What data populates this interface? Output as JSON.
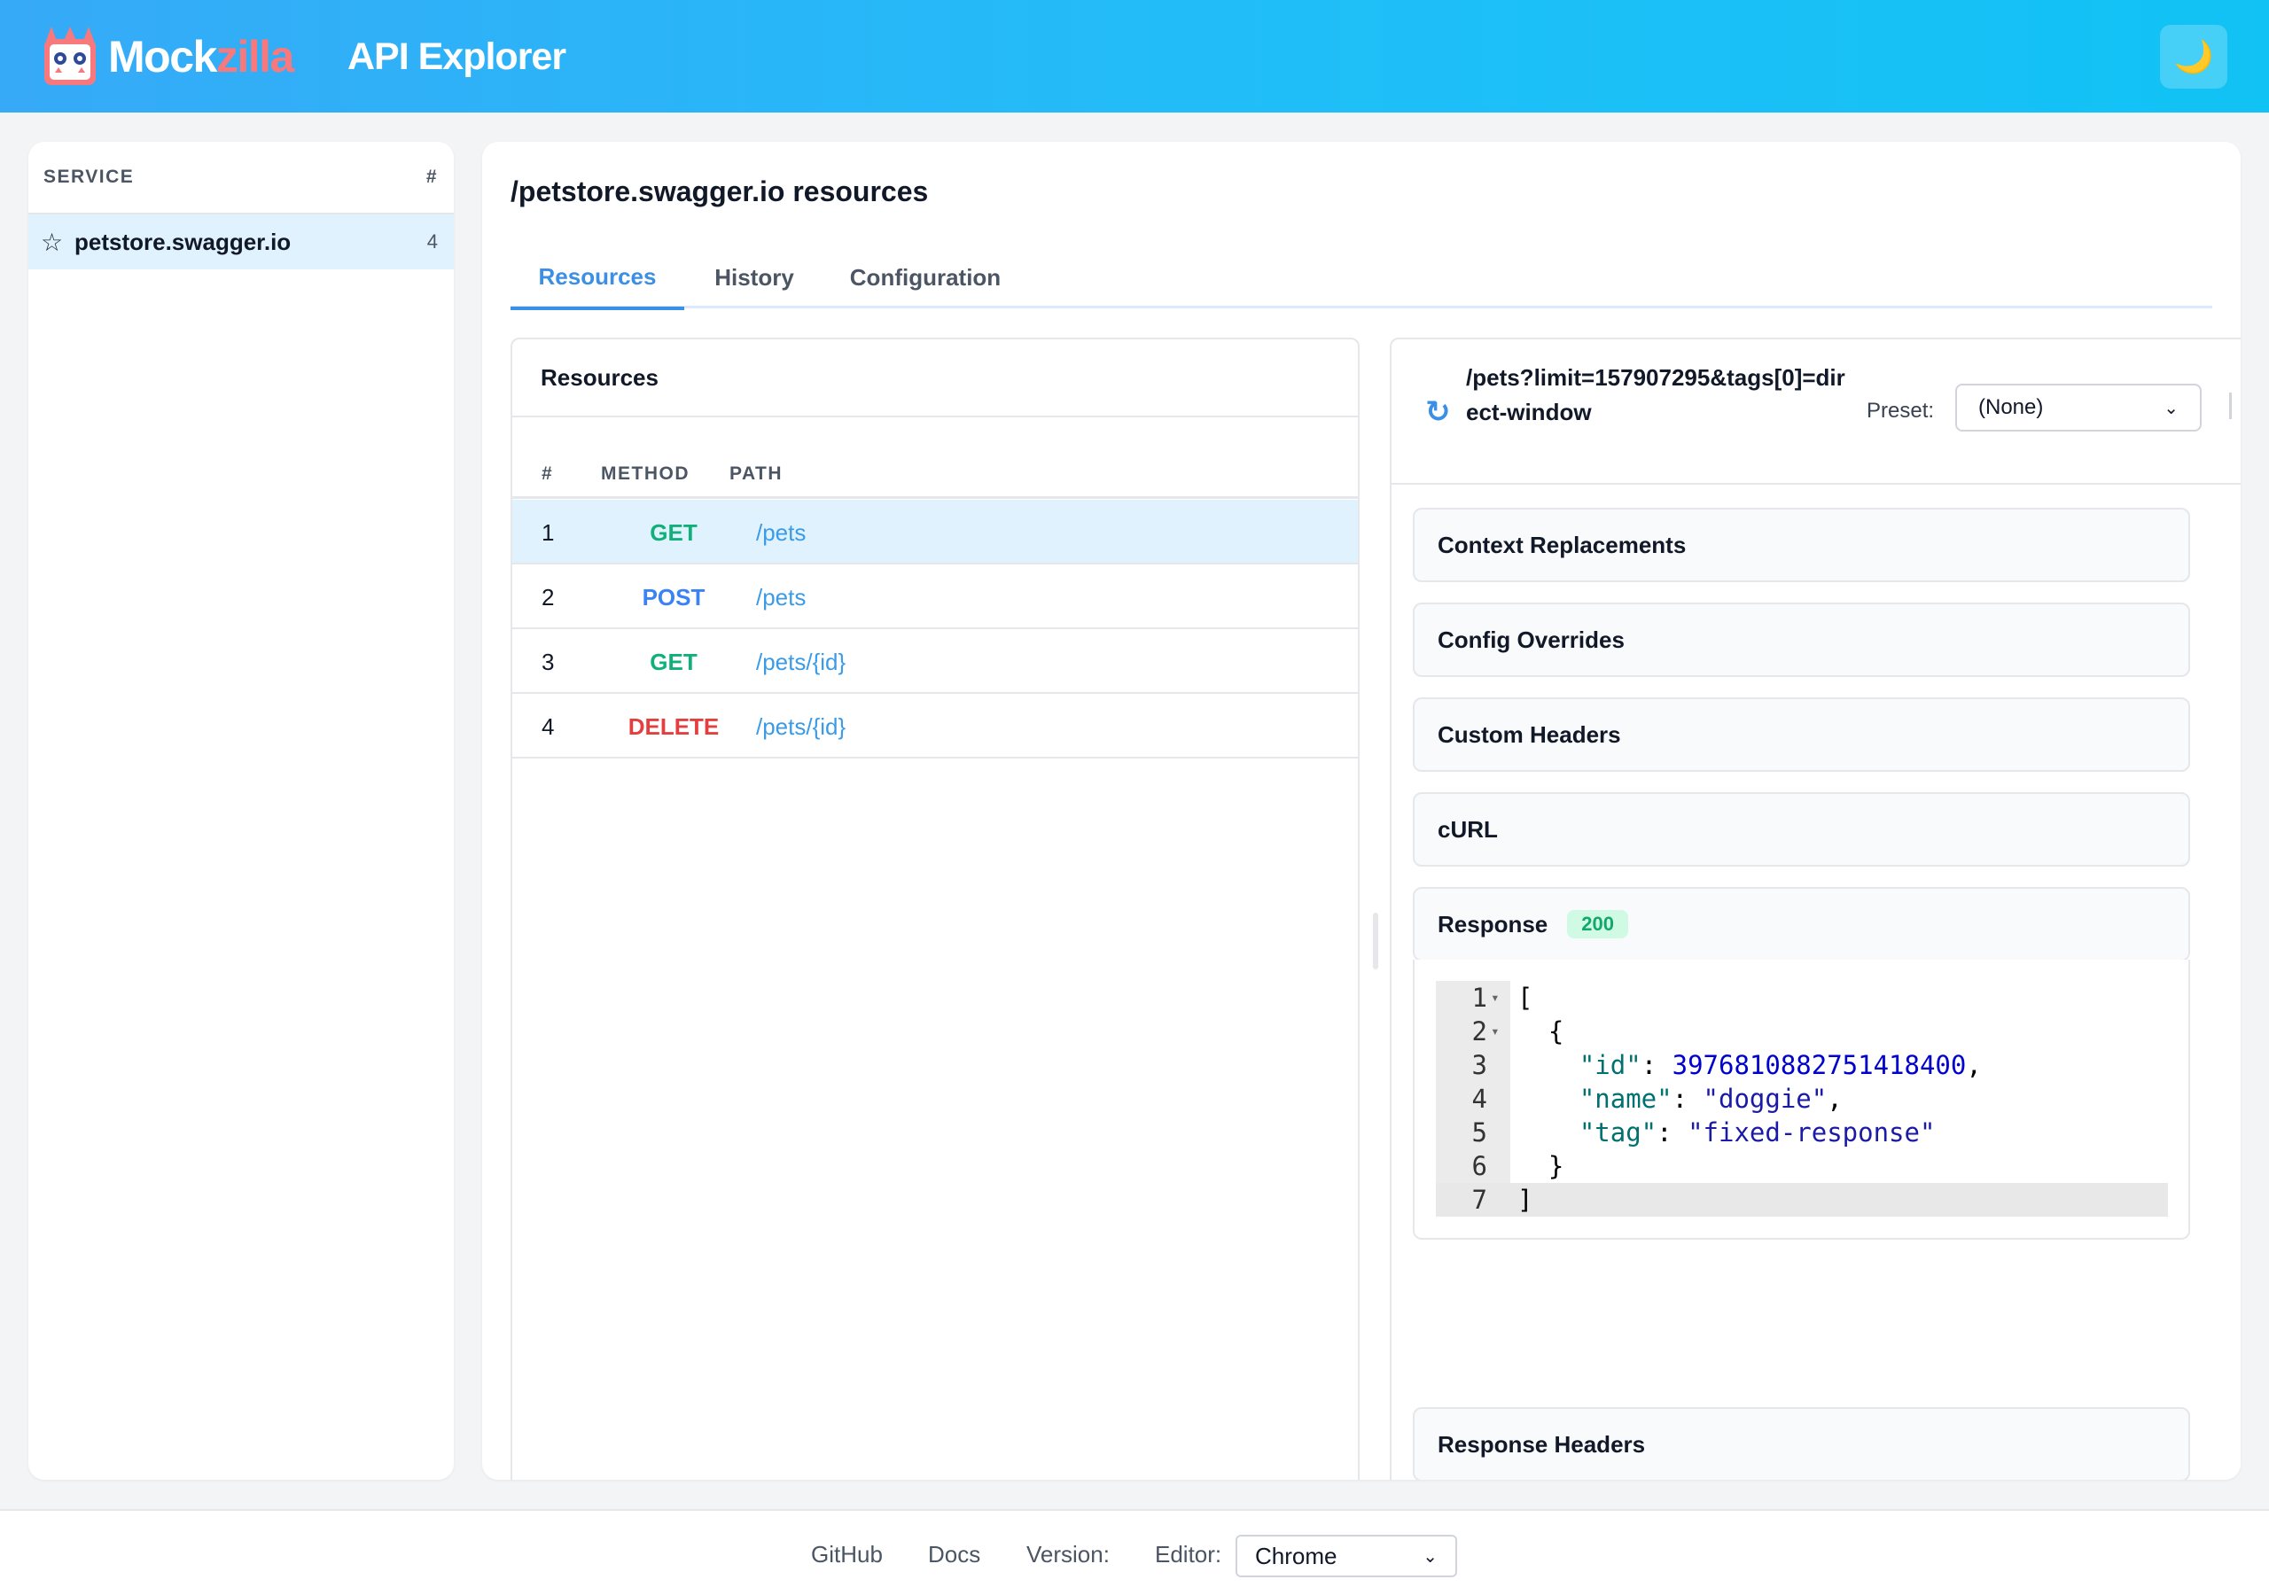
{
  "header": {
    "brand_part1": "Mock",
    "brand_part2": "zilla",
    "title": "API Explorer",
    "theme_icon": "moon-icon",
    "colors": {
      "accent": "#3b8fe6",
      "brand_red": "#f7797d"
    }
  },
  "sidebar": {
    "col_service": "SERVICE",
    "col_count": "#",
    "items": [
      {
        "label": "petstore.swagger.io",
        "count": "4"
      }
    ]
  },
  "main": {
    "title": "/petstore.swagger.io resources",
    "tabs": [
      {
        "label": "Resources",
        "active": true
      },
      {
        "label": "History",
        "active": false
      },
      {
        "label": "Configuration",
        "active": false
      }
    ]
  },
  "resources": {
    "title": "Resources",
    "columns": [
      "#",
      "METHOD",
      "PATH"
    ],
    "rows": [
      {
        "num": "1",
        "method": "GET",
        "path": "/pets",
        "color": "#10b07a"
      },
      {
        "num": "2",
        "method": "POST",
        "path": "/pets",
        "color": "#3b82f6"
      },
      {
        "num": "3",
        "method": "GET",
        "path": "/pets/{id}",
        "color": "#10b07a"
      },
      {
        "num": "4",
        "method": "DELETE",
        "path": "/pets/{id}",
        "color": "#e53e3e"
      }
    ]
  },
  "detail": {
    "url": "/pets?limit=157907295&tags[0]=direct-window",
    "preset_label": "Preset:",
    "preset_value": "(None)",
    "sections": {
      "context": "Context Replacements",
      "config": "Config Overrides",
      "headers": "Custom Headers",
      "curl": "cURL",
      "response": "Response",
      "response_status": "200",
      "response_headers": "Response Headers"
    },
    "code": {
      "id_key": "\"id\"",
      "id_val": "3976810882751418400",
      "name_key": "\"name\"",
      "name_val": "\"doggie\"",
      "tag_key": "\"tag\"",
      "tag_val": "\"fixed-response\""
    }
  },
  "footer": {
    "github": "GitHub",
    "docs": "Docs",
    "version": "Version:",
    "editor_label": "Editor:",
    "editor_value": "Chrome"
  }
}
